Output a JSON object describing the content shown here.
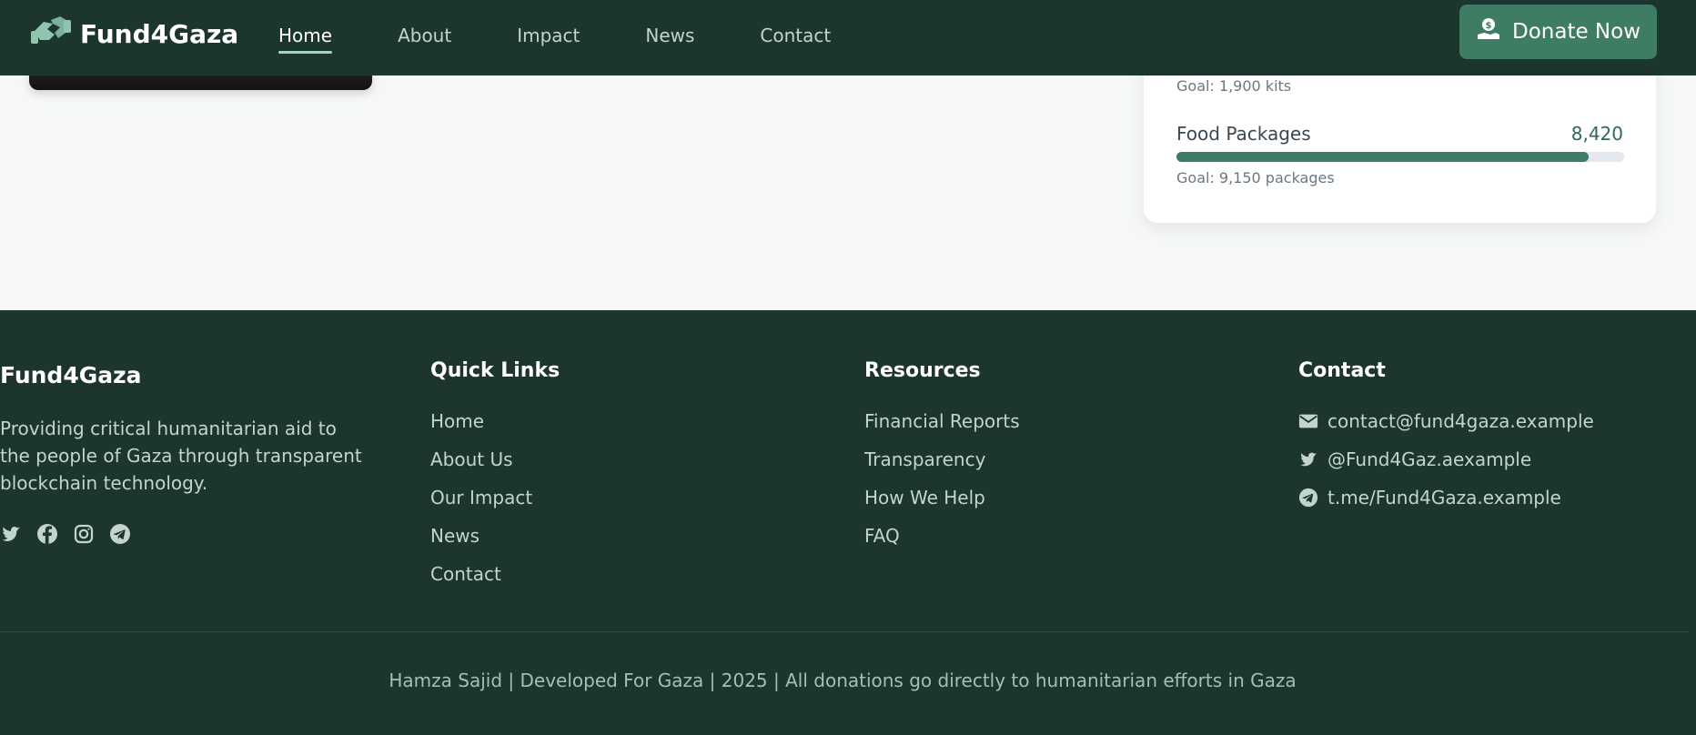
{
  "navbar": {
    "brand": "Fund4Gaza",
    "links": [
      {
        "label": "Home",
        "active": true
      },
      {
        "label": "About",
        "active": false
      },
      {
        "label": "Impact",
        "active": false
      },
      {
        "label": "News",
        "active": false
      },
      {
        "label": "Contact",
        "active": false
      }
    ],
    "donate_label": "Donate Now"
  },
  "stats": {
    "previous_goal": "Goal: 1,900 kits",
    "items": [
      {
        "label": "Food Packages",
        "value": "8,420",
        "goal": "Goal: 9,150 packages",
        "progress_fraction": 0.92
      }
    ]
  },
  "footer": {
    "brand": "Fund4Gaza",
    "description": "Providing critical humanitarian aid to the people of Gaza through transparent blockchain technology.",
    "social_icons": [
      "twitter-icon",
      "facebook-icon",
      "instagram-icon",
      "telegram-icon"
    ],
    "quick_links": {
      "title": "Quick Links",
      "items": [
        "Home",
        "About Us",
        "Our Impact",
        "News",
        "Contact"
      ]
    },
    "resources": {
      "title": "Resources",
      "items": [
        "Financial Reports",
        "Transparency",
        "How We Help",
        "FAQ"
      ]
    },
    "contact": {
      "title": "Contact",
      "items": [
        {
          "icon": "envelope-icon",
          "text": "contact@fund4gaza.example"
        },
        {
          "icon": "twitter-icon",
          "text": "@Fund4Gaz.aexample"
        },
        {
          "icon": "telegram-icon",
          "text": "t.me/Fund4Gaza.example"
        }
      ]
    },
    "copyright": "Hamza Sajid | Developed For Gaza | 2025 | All donations go directly to humanitarian efforts in Gaza"
  },
  "colors": {
    "dark_green": "#1c352e",
    "accent": "#3e7c63",
    "link": "#c3d4cd"
  }
}
